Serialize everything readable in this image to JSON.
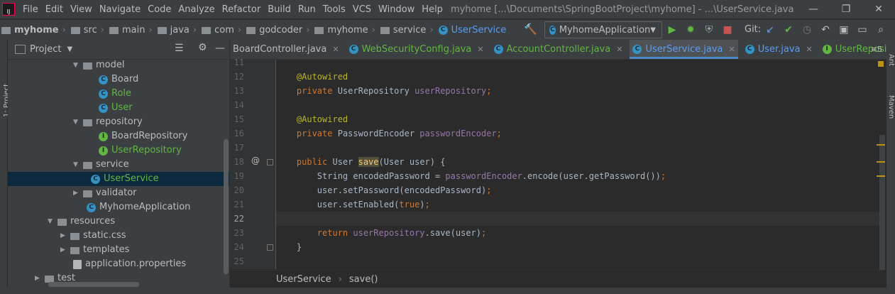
{
  "menu": {
    "items": [
      "File",
      "Edit",
      "View",
      "Navigate",
      "Code",
      "Analyze",
      "Refactor",
      "Build",
      "Run",
      "Tools",
      "VCS",
      "Window",
      "Help"
    ],
    "window_title": "myhome [...\\Documents\\SpringBootProject\\myhome] - ...\\UserService.java",
    "controls": [
      "—",
      "❐",
      "✕"
    ]
  },
  "breadcrumb": {
    "items": [
      "myhome",
      "src",
      "main",
      "java",
      "com",
      "godcoder",
      "myhome",
      "service",
      "UserService"
    ],
    "run_config": "MyhomeApplication",
    "git_label": "Git:"
  },
  "project_panel": {
    "title": "Project",
    "tree": [
      {
        "label": "model",
        "type": "folder",
        "arrow": "▼",
        "color": "default"
      },
      {
        "label": "Board",
        "type": "class",
        "color": "default"
      },
      {
        "label": "Role",
        "type": "class",
        "color": "green"
      },
      {
        "label": "User",
        "type": "class",
        "color": "green"
      },
      {
        "label": "repository",
        "type": "folder",
        "arrow": "▼",
        "color": "default"
      },
      {
        "label": "BoardRepository",
        "type": "interface",
        "color": "default"
      },
      {
        "label": "UserRepository",
        "type": "interface",
        "color": "green"
      },
      {
        "label": "service",
        "type": "folder",
        "arrow": "▼",
        "color": "default"
      },
      {
        "label": "UserService",
        "type": "class",
        "color": "green",
        "selected": true
      },
      {
        "label": "validator",
        "type": "folder",
        "arrow": "▶",
        "color": "default"
      },
      {
        "label": "MyhomeApplication",
        "type": "class",
        "color": "default"
      },
      {
        "label": "resources",
        "type": "folder",
        "arrow": "▼",
        "color": "default"
      },
      {
        "label": "static.css",
        "type": "folder",
        "arrow": "▶",
        "color": "default"
      },
      {
        "label": "templates",
        "type": "folder",
        "arrow": "▶",
        "color": "default"
      },
      {
        "label": "application.properties",
        "type": "file",
        "color": "default"
      },
      {
        "label": "test",
        "type": "folder",
        "arrow": "▶",
        "color": "default"
      }
    ]
  },
  "tabs": [
    {
      "label": "BoardController.java",
      "icon": "none",
      "color": "default"
    },
    {
      "label": "WebSecurityConfig.java",
      "icon": "class",
      "color": "green"
    },
    {
      "label": "AccountController.java",
      "icon": "class",
      "color": "green"
    },
    {
      "label": "UserService.java",
      "icon": "class",
      "color": "blue",
      "active": true
    },
    {
      "label": "User.java",
      "icon": "class",
      "color": "blue"
    },
    {
      "label": "UserRepository.java",
      "icon": "interface",
      "color": "green"
    }
  ],
  "tab_overflow": "≡5",
  "side_labels": {
    "left": "1: Project",
    "right_top": "Ant",
    "right_bottom": "Maven"
  },
  "code": {
    "lines": [
      {
        "num": "11",
        "text": ""
      },
      {
        "num": "12",
        "text": "    @Autowired"
      },
      {
        "num": "13",
        "text": "    private UserRepository userRepository;"
      },
      {
        "num": "14",
        "text": ""
      },
      {
        "num": "15",
        "text": "    @Autowired"
      },
      {
        "num": "16",
        "text": "    private PasswordEncoder passwordEncoder;"
      },
      {
        "num": "17",
        "text": ""
      },
      {
        "num": "18",
        "text": "    public User save(User user) {"
      },
      {
        "num": "19",
        "text": "        String encodedPassword = passwordEncoder.encode(user.getPassword());"
      },
      {
        "num": "20",
        "text": "        user.setPassword(encodedPassword);"
      },
      {
        "num": "21",
        "text": "        user.setEnabled(true);"
      },
      {
        "num": "22",
        "text": ""
      },
      {
        "num": "23",
        "text": "        return userRepository.save(user);"
      },
      {
        "num": "24",
        "text": "    }"
      },
      {
        "num": "25",
        "text": ""
      }
    ],
    "current_line": "22",
    "gutter_mark": "@"
  },
  "editor_breadcrumb": {
    "class": "UserService",
    "method": "save()"
  }
}
